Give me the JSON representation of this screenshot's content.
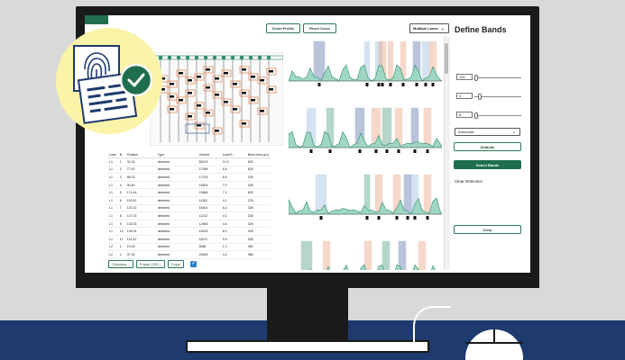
{
  "toolbar": {
    "zoom_profile": "Zoom Profile",
    "reset_zoom": "Reset Zoom",
    "lanes_select": "Multiple Lanes"
  },
  "panel": {
    "title": "Define Bands",
    "inputs": [
      "100",
      "4",
      "8"
    ],
    "mode_select": "Automatic",
    "defaults_label": "Defaults",
    "detect_label": "Detect Bands",
    "clear_detection_label": "Clear Detection",
    "clear_label": "Clear"
  },
  "table": {
    "headers": [
      "Lane",
      "B",
      "Position",
      "Type",
      "Volume",
      "Lane%",
      "Band Area (px)"
    ],
    "rows": [
      [
        "L1",
        "1",
        "31.43",
        "detected",
        "83476",
        "12.5",
        "625"
      ],
      [
        "L1",
        "2",
        "77.42",
        "detected",
        "17996",
        "6.6",
        "625"
      ],
      [
        "L1",
        "3",
        "88.02",
        "detected",
        "17076",
        "6.5",
        "328"
      ],
      [
        "L1",
        "4",
        "90.60",
        "detected",
        "18904",
        "7.0",
        "328"
      ],
      [
        "L1",
        "5",
        "174.46",
        "detected",
        "19666",
        "7.2",
        "625"
      ],
      [
        "L1",
        "6",
        "119.00",
        "detected",
        "11182",
        "4.1",
        "276"
      ],
      [
        "L1",
        "7",
        "120.22",
        "detected",
        "16401",
        "6.2",
        "328"
      ],
      [
        "L1",
        "8",
        "127.23",
        "detected",
        "11212",
        "4.1",
        "238"
      ],
      [
        "L1",
        "9",
        "132.03",
        "detected",
        "12969",
        "4.6",
        "328"
      ],
      [
        "L1",
        "10",
        "139.04",
        "detected",
        "16233",
        "6.0",
        "328"
      ],
      [
        "L1",
        "11",
        "141.87",
        "detected",
        "16071",
        "5.9",
        "328"
      ],
      [
        "L2",
        "1",
        "19.43",
        "detected",
        "6084",
        "1.2",
        "455"
      ],
      [
        "L2",
        "2",
        "37.04",
        "detected",
        "23496",
        "4.2",
        "456"
      ]
    ]
  },
  "footer": {
    "columns_label": "Columns...",
    "export_label": "Export CSV...",
    "copy_label": "Copy"
  },
  "colors": {
    "accent": "#1f6f4e",
    "band_blue": "#3a5a9a",
    "band_orange": "#e8916a",
    "band_green": "#2e8b6a",
    "floor": "#1e3a6e"
  }
}
